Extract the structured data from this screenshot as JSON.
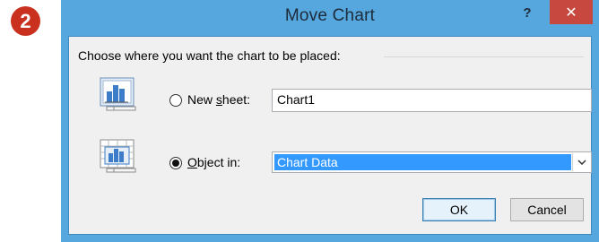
{
  "step_badge": "2",
  "dialog": {
    "title": "Move Chart",
    "help_label": "?",
    "close_label": "✕",
    "group_label": "Choose where you want the chart to be placed:",
    "new_sheet": {
      "label_prefix": "New ",
      "label_accel": "s",
      "label_suffix": "heet:",
      "value": "Chart1",
      "selected": false
    },
    "object_in": {
      "label_accel": "O",
      "label_suffix": "bject in:",
      "value": "Chart Data",
      "selected": true
    },
    "ok_label": "OK",
    "cancel_label": "Cancel"
  },
  "colors": {
    "frame": "#55a7dd",
    "close": "#c7483f",
    "badge": "#c9301d",
    "selection": "#3399ff"
  }
}
